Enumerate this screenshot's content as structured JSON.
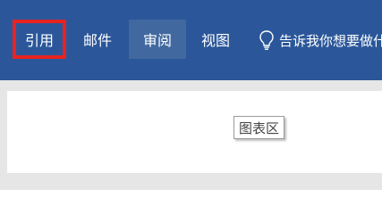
{
  "ribbon": {
    "tabs": [
      {
        "label": "引用"
      },
      {
        "label": "邮件"
      },
      {
        "label": "审阅"
      },
      {
        "label": "视图"
      }
    ],
    "tell_me": "告诉我你想要做什么"
  },
  "tooltip": {
    "text": "图表区"
  },
  "colors": {
    "ribbon_background": "#2b579a",
    "active_tab_background": "#41689f",
    "highlight_box": "#e8231f",
    "workspace_background": "#e6e6e6"
  }
}
